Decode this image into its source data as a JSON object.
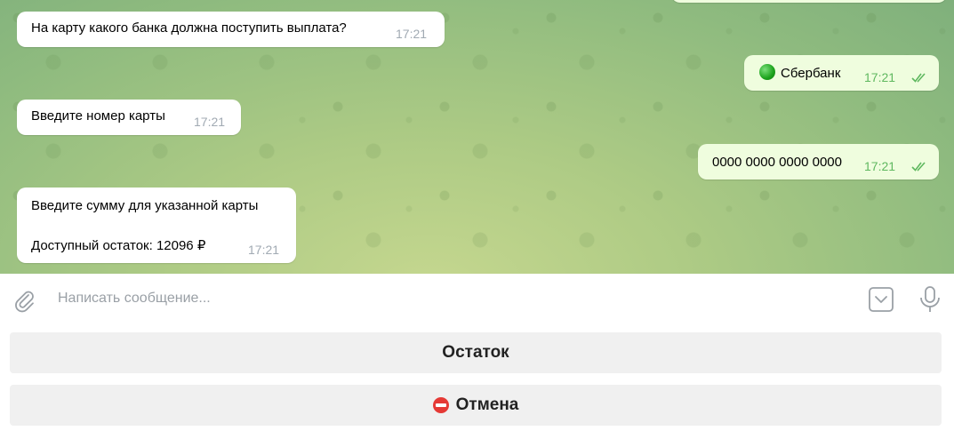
{
  "messages": [
    {
      "side": "incoming",
      "text": "На карту какого банка должна поступить выплата?",
      "time": "17:21"
    },
    {
      "side": "outgoing",
      "text": "Сбербанк",
      "time": "17:21",
      "icon": "green-circle-emoji"
    },
    {
      "side": "incoming",
      "text": "Введите номер карты",
      "time": "17:21"
    },
    {
      "side": "outgoing",
      "text": "0000 0000 0000 0000",
      "time": "17:21"
    },
    {
      "side": "incoming",
      "text_line1": "Введите сумму для указанной карты",
      "text_line2": "Доступный остаток: 12096 ₽",
      "time": "17:21"
    }
  ],
  "input": {
    "placeholder": "Написать сообщение..."
  },
  "keyboard": {
    "button1": "Остаток",
    "button2": "Отмена",
    "button2_icon": "no-entry-emoji"
  },
  "colors": {
    "incoming_bubble": "#ffffff",
    "outgoing_bubble": "#effdde",
    "time_outgoing": "#5fb85f"
  }
}
